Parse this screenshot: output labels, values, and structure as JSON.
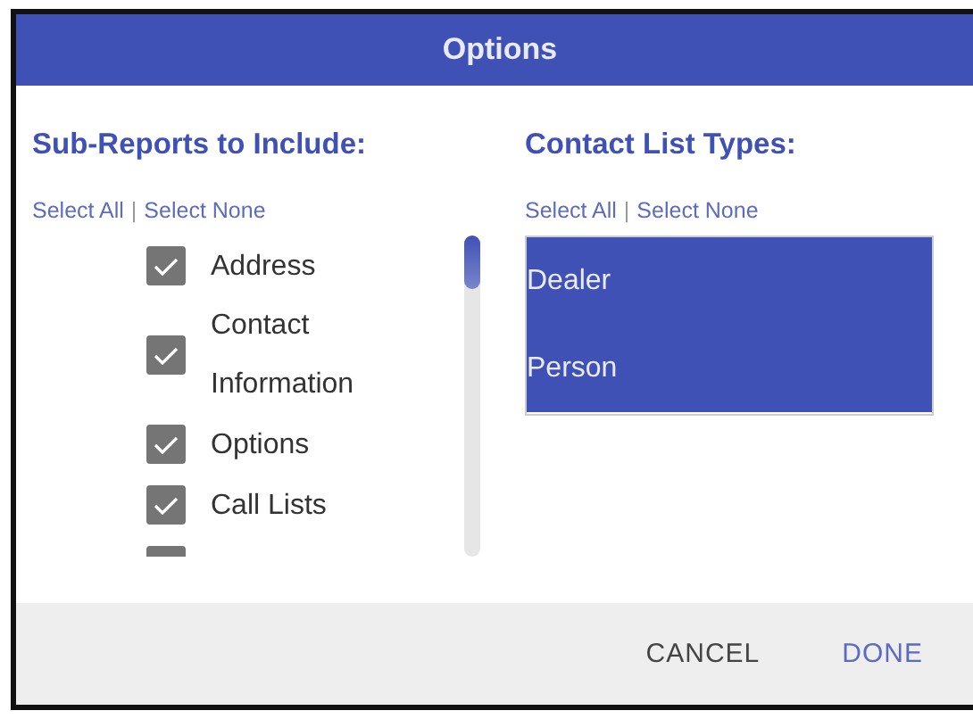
{
  "dialog": {
    "title": "Options"
  },
  "sub_reports": {
    "heading": "Sub-Reports to Include:",
    "select_all": "Select All",
    "separator": "|",
    "select_none": "Select None",
    "items": [
      {
        "label": "Address",
        "checked": true
      },
      {
        "label": "Contact Information",
        "checked": true
      },
      {
        "label": "Options",
        "checked": true
      },
      {
        "label": "Call Lists",
        "checked": true
      },
      {
        "checked": true
      }
    ]
  },
  "contact_list_types": {
    "heading": "Contact List Types:",
    "select_all": "Select All",
    "separator": "|",
    "select_none": "Select None",
    "items": [
      {
        "label": "Dealer",
        "selected": true
      },
      {
        "label": "Person",
        "selected": true
      }
    ]
  },
  "buttons": [
    {
      "label": "CANCEL",
      "kind": "secondary"
    },
    {
      "label": "DONE",
      "kind": "primary"
    }
  ]
}
